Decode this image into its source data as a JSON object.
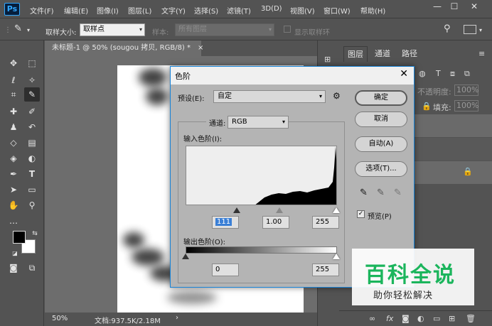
{
  "app": {
    "logo": "Ps"
  },
  "menu": [
    "文件(F)",
    "编辑(E)",
    "图像(I)",
    "图层(L)",
    "文字(Y)",
    "选择(S)",
    "滤镜(T)",
    "3D(D)",
    "视图(V)",
    "窗口(W)",
    "帮助(H)"
  ],
  "window_controls": {
    "minimize": "—",
    "maximize": "☐",
    "close": "✕"
  },
  "options": {
    "sample_size_label": "取样大小:",
    "sample_size_value": "取样点",
    "sample_label": "样本:",
    "sample_value": "所有图层",
    "show_ring_label": "显示取样环"
  },
  "document": {
    "tab_title": "未标题-1 @ 50% (sougou 拷贝, RGB/8) *",
    "tab_close": "×",
    "zoom": "50%",
    "doc_info": "文档:937.5K/2.18M",
    "status_arrow": "›"
  },
  "panels": {
    "tabs": [
      "图层",
      "通道",
      "路径"
    ],
    "opacity_label": "不透明度:",
    "opacity_value": "100%",
    "fill_label": "填充:",
    "fill_value": "100%"
  },
  "dialog": {
    "title": "色阶",
    "preset_label": "预设(E):",
    "preset_value": "自定",
    "channel_label": "通道:",
    "channel_value": "RGB",
    "input_label": "输入色阶(I):",
    "input_black": "111",
    "input_gamma": "1.00",
    "input_white": "255",
    "output_label": "输出色阶(O):",
    "output_black": "0",
    "output_white": "255",
    "ok": "确定",
    "cancel": "取消",
    "auto": "自动(A)",
    "options": "选项(T)...",
    "preview": "预览(P)",
    "preview_checked": true
  },
  "watermark": {
    "logo": "百科全说",
    "sub": "助你轻松解决"
  }
}
